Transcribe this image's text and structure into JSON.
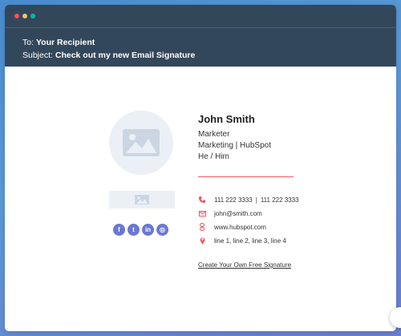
{
  "email": {
    "to_label": "To:",
    "to_value": "Your Recipient",
    "subject_label": "Subject:",
    "subject_value": "Check out my new Email Signature"
  },
  "signature": {
    "name": "John Smith",
    "title": "Marketer",
    "department": "Marketing | HubSpot",
    "pronouns": "He / Him",
    "phone": "111 222 3333",
    "mobile": "111 222 3333",
    "phone_separator": "|",
    "email": "john@smith.com",
    "website": "www.hubspot.com",
    "address": "line 1, line 2, line 3, line 4",
    "cta": "Create Your Own Free Signature",
    "socials": [
      {
        "icon": "facebook-icon",
        "glyph": "f"
      },
      {
        "icon": "twitter-icon",
        "glyph": "t"
      },
      {
        "icon": "linkedin-icon",
        "glyph": "in"
      },
      {
        "icon": "instagram-icon",
        "glyph": "◎"
      }
    ]
  },
  "colors": {
    "header_bg": "#33475b",
    "accent": "#f2545b",
    "social": "#6a78d1",
    "placeholder": "#eaf0f6"
  }
}
